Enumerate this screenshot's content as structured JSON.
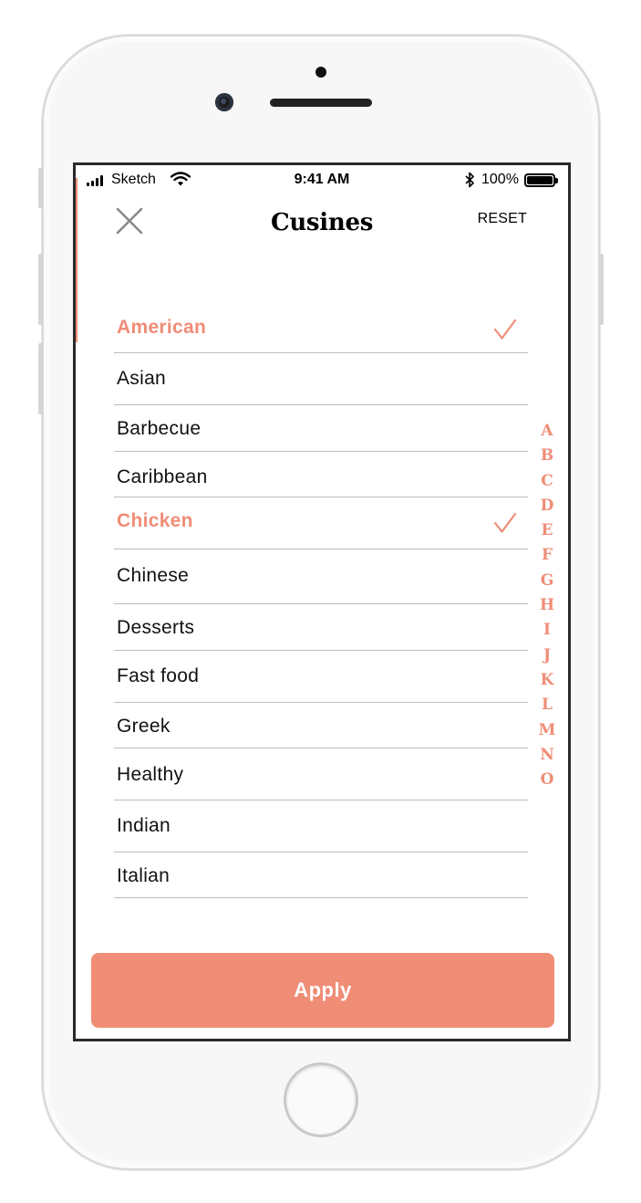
{
  "status_bar": {
    "carrier": "Sketch",
    "time": "9:41 AM",
    "battery_percent": "100%"
  },
  "header": {
    "title": "Cusines",
    "reset_label": "RESET"
  },
  "cuisines": [
    {
      "label": "American",
      "selected": true
    },
    {
      "label": "Asian",
      "selected": false
    },
    {
      "label": "Barbecue",
      "selected": false
    },
    {
      "label": "Caribbean",
      "selected": false
    },
    {
      "label": "Chicken",
      "selected": true
    },
    {
      "label": "Chinese",
      "selected": false
    },
    {
      "label": "Desserts",
      "selected": false
    },
    {
      "label": "Fast food",
      "selected": false
    },
    {
      "label": "Greek",
      "selected": false
    },
    {
      "label": "Healthy",
      "selected": false
    },
    {
      "label": "Indian",
      "selected": false
    },
    {
      "label": "Italian",
      "selected": false
    }
  ],
  "alphabet_index": [
    "A",
    "B",
    "C",
    "D",
    "E",
    "F",
    "G",
    "H",
    "I",
    "J",
    "K",
    "L",
    "M",
    "N",
    "O"
  ],
  "apply_label": "Apply",
  "colors": {
    "accent": "#f08d77",
    "text": "#111111",
    "divider": "#bdbdbd"
  },
  "icons": {
    "close": "close-icon",
    "check": "checkmark-icon",
    "wifi": "wifi-icon",
    "bluetooth": "bluetooth-icon",
    "battery": "battery-icon",
    "signal": "signal-icon"
  }
}
